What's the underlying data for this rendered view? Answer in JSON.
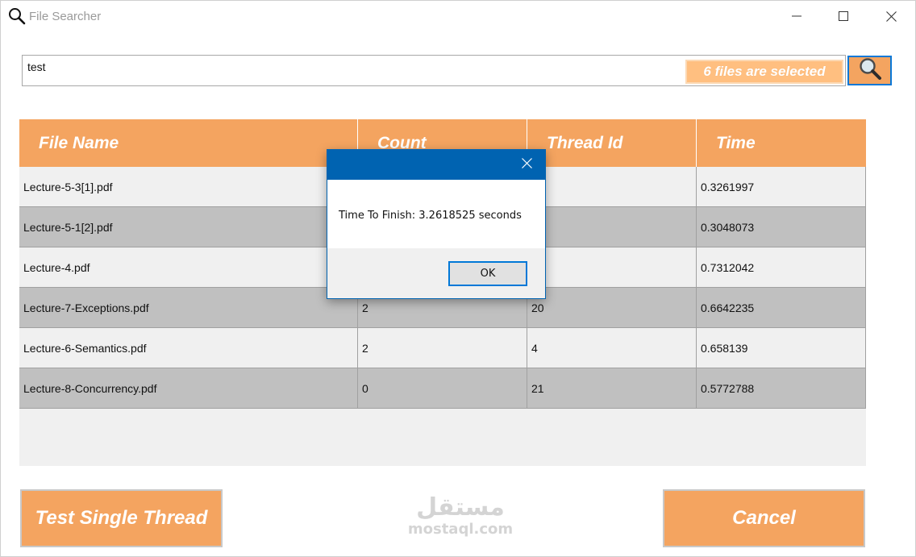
{
  "window": {
    "title": "File Searcher",
    "icons": {
      "app": "magnifier-icon",
      "minimize": "minimize-icon",
      "maximize": "maximize-icon",
      "close": "close-icon"
    }
  },
  "search": {
    "value": "test",
    "selected_badge": "6 files are selected",
    "button_icon": "magnifier-icon"
  },
  "grid": {
    "columns": [
      "File Name",
      "Count",
      "Thread Id",
      "Time"
    ],
    "rows": [
      {
        "file": "Lecture-5-3[1].pdf",
        "count": "",
        "thread": "",
        "time": "0.3261997"
      },
      {
        "file": "Lecture-5-1[2].pdf",
        "count": "",
        "thread": "",
        "time": "0.3048073"
      },
      {
        "file": "Lecture-4.pdf",
        "count": "",
        "thread": "",
        "time": "0.7312042"
      },
      {
        "file": "Lecture-7-Exceptions.pdf",
        "count": "2",
        "thread": "20",
        "time": "0.6642235"
      },
      {
        "file": "Lecture-6-Semantics.pdf",
        "count": "2",
        "thread": "4",
        "time": "0.658139"
      },
      {
        "file": "Lecture-8-Concurrency.pdf",
        "count": "0",
        "thread": "21",
        "time": "0.5772788"
      }
    ]
  },
  "buttons": {
    "single_thread": "Test Single Thread",
    "cancel": "Cancel"
  },
  "watermark": {
    "logo": "مستقل",
    "text": "mostaql.com"
  },
  "dialog": {
    "message": "Time To Finish: 3.2618525 seconds",
    "ok": "OK"
  },
  "colors": {
    "accent": "#f4a460",
    "badge": "#ffbf80",
    "row_dark": "#c0c0c0",
    "row_light": "#f0f0f0",
    "dialog_title": "#0063b1",
    "focus": "#0078d7"
  }
}
